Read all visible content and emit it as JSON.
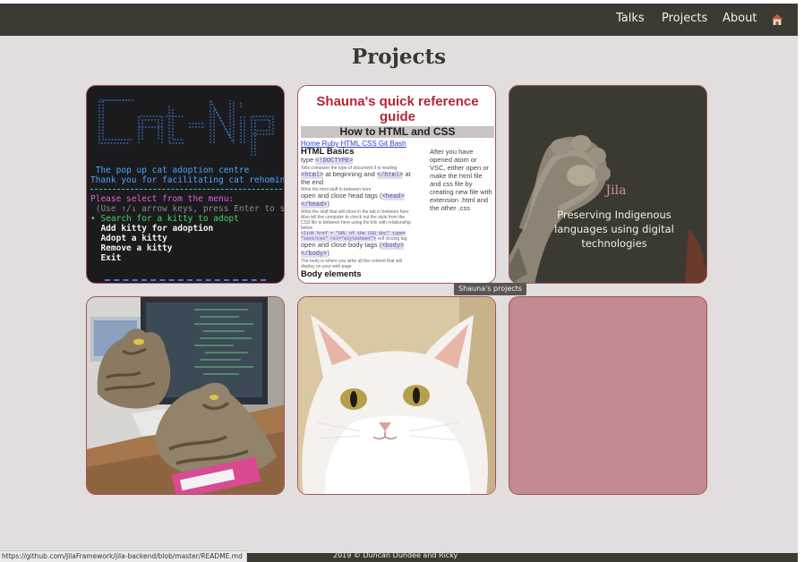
{
  "nav": {
    "links": [
      "Talks",
      "Projects",
      "About"
    ],
    "home_icon": "home-icon"
  },
  "page": {
    "title": "Projects"
  },
  "projects": {
    "catnip": {
      "logo_text": "Cat-Nip",
      "subtitle": " The pop up cat adoption centre",
      "thanks": "Thank you for facilitating cat rehoming!",
      "menu_prompt": "Please select from the menu:",
      "hint": " (Use ↑/↓ arrow keys, press Enter to sel",
      "selected": "• Search for a kitty to adopt",
      "options": [
        "  Add kitty for adoption",
        "  Adopt a kitty",
        "  Remove a kitty",
        "  Exit"
      ]
    },
    "reference": {
      "title": "Shauna's quick reference guide",
      "band": "How to HTML and CSS",
      "links": [
        "Home",
        "Ruby",
        "HTML",
        "CSS",
        "Git Bash"
      ],
      "heading_basics": "HTML Basics",
      "type_label": "type",
      "doctype_tag": "<!DOCTYPE>",
      "small_1": "Tells computer the type of document it is reading",
      "html_tag": "<html>",
      "html_close_tag": "</html>",
      "at_beginning": "at beginning and",
      "at_word": "at",
      "the_end": "the end",
      "small_2": "Write the html stuff in between here",
      "open_close_head": "open and close head tags",
      "head_tag": "<head>",
      "head_close_tag": "</head>",
      "small_3": "Write the stuff that will show in the tab in between here",
      "small_4": "Also tell the computer to check out the style from the",
      "small_5": "CSS file in between here using the link with relationship",
      "small_6": "below",
      "link_code": "<link href = \"URL of the CSS doc\" type=",
      "link_code_2": "\"text/css\" rel=\"stylesheet\">",
      "self_closing": "self closing tag",
      "open_close_body": "open and close body tags",
      "body_tag": "<body>",
      "body_close_tag": "</body>",
      "small_7": "The body is where you write all the content that will",
      "small_8": "display on your web page",
      "heading_elements": "Body elements",
      "right_text": "After you have opened atom or VSC, either open or make the html file and css file by creating new file with extension .html and the other .css"
    },
    "jila": {
      "name": "Jila",
      "tagline": "Preserving Indigenous languages using digital technologies"
    },
    "photos": [
      "tabby-cats-on-desk-photo",
      "white-cat-portrait-photo"
    ],
    "placeholder_color": "#c38a90"
  },
  "tooltip": "Shauna's projects",
  "footer": {
    "copyright": "2019 © Duncan Dundee and Ricky"
  },
  "status_bar": {
    "url": "https://github.com/JilaFramework/jila-backend/blob/master/README.md"
  },
  "colors": {
    "nav_bg": "#3d3a34",
    "page_bg": "#e1dedd",
    "card_border": "#a7545d",
    "accent_pink": "#d28f97"
  }
}
